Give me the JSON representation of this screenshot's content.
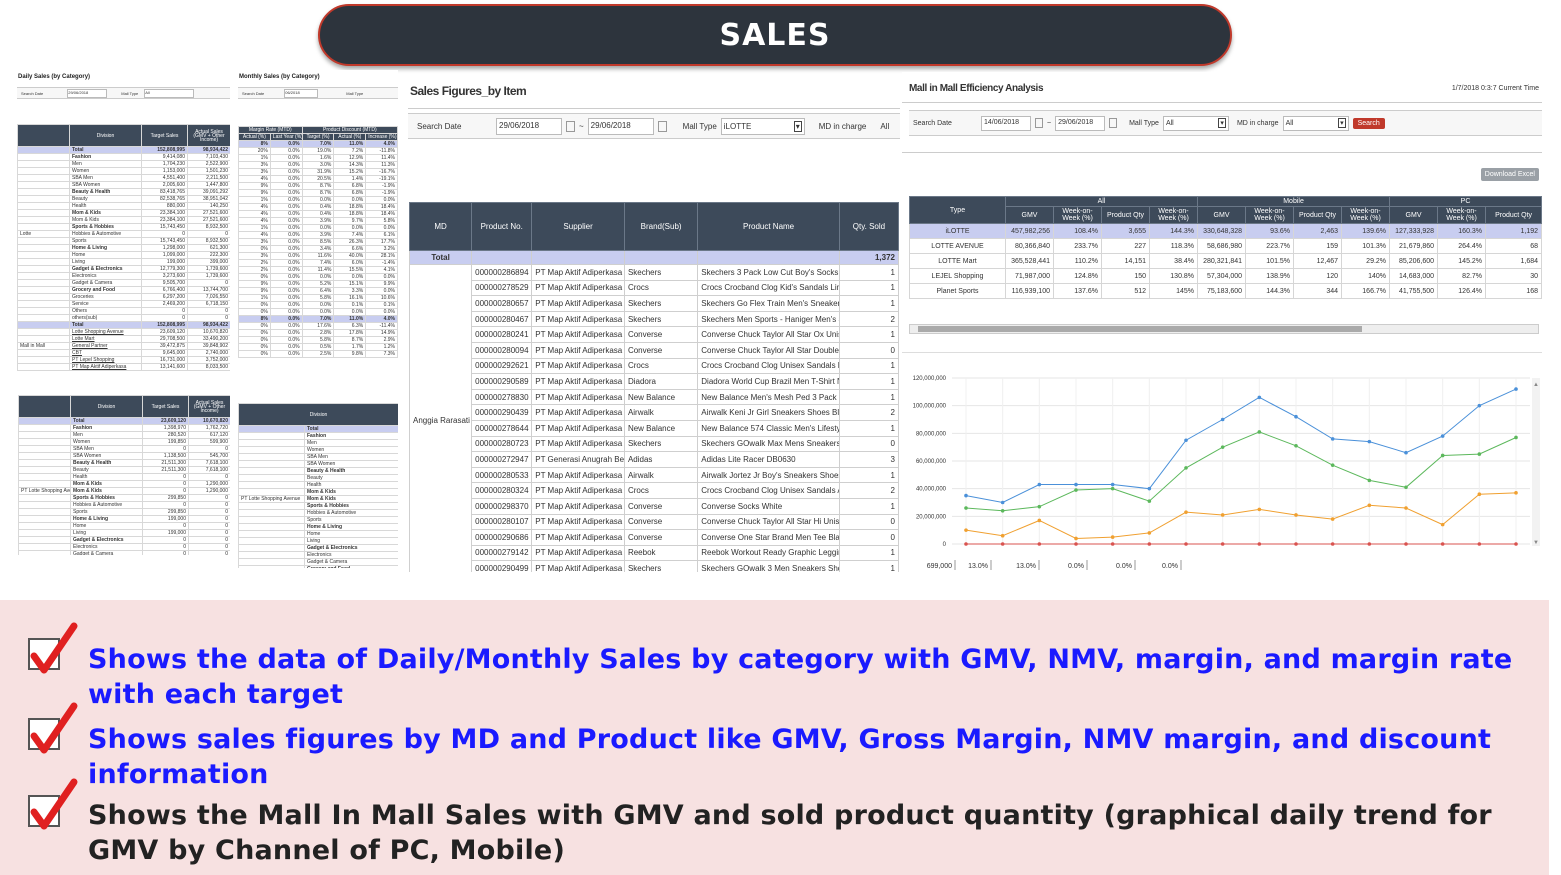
{
  "title": "SALES",
  "daily": {
    "title": "Daily Sales (by Category)",
    "search_label": "Search Date",
    "date": "29/06/2018",
    "mall_type_label": "Mall Type",
    "mall_type_value": "All",
    "headers": [
      "Division",
      "Target Sales",
      "Actual Sales (GMV + Other Income)"
    ],
    "group1": "Lotte",
    "group2": "Mall in Mall",
    "rows": [
      [
        "Total",
        "152,808,995",
        "98,934,422"
      ],
      [
        "Fashion",
        "9,414,080",
        "7,103,430"
      ],
      [
        "Men",
        "1,704,230",
        "2,522,900"
      ],
      [
        "Women",
        "1,153,000",
        "1,501,230"
      ],
      [
        "SBA Men",
        "4,551,400",
        "2,211,500"
      ],
      [
        "SBA Women",
        "2,005,600",
        "1,447,800"
      ],
      [
        "Beauty & Health",
        "83,418,765",
        "39,091,292"
      ],
      [
        "Beauty",
        "82,538,765",
        "38,951,042"
      ],
      [
        "Health",
        "880,000",
        "140,250"
      ],
      [
        "Mom & Kids",
        "23,384,100",
        "27,521,600"
      ],
      [
        "Mom & Kids",
        "23,384,100",
        "27,521,600"
      ],
      [
        "Sports & Hobbies",
        "15,743,450",
        "8,932,500"
      ],
      [
        "Hobbies & Automotive",
        "0",
        "0"
      ],
      [
        "Sports",
        "15,743,450",
        "8,932,500"
      ],
      [
        "Home & Living",
        "1,298,000",
        "621,300"
      ],
      [
        "Home",
        "1,099,000",
        "222,300"
      ],
      [
        "Living",
        "199,000",
        "399,000"
      ],
      [
        "Gadget & Electronics",
        "12,779,300",
        "1,739,600"
      ],
      [
        "Electronics",
        "3,273,600",
        "1,739,600"
      ],
      [
        "Gadget & Camera",
        "9,505,700",
        "0"
      ],
      [
        "Grocery and Food",
        "6,766,400",
        "13,744,700"
      ],
      [
        "Groceries",
        "6,297,200",
        "7,026,550"
      ],
      [
        "Service",
        "2,469,200",
        "6,718,150"
      ],
      [
        "Others",
        "0",
        "0"
      ],
      [
        "others(sub)",
        "0",
        "0"
      ],
      [
        "Total",
        "152,808,995",
        "98,934,422"
      ],
      [
        "Lotte Shopping Avenue",
        "23,609,120",
        "10,670,820"
      ],
      [
        "Lotte Mart",
        "29,708,500",
        "33,490,200"
      ],
      [
        "General Partner",
        "39,472,875",
        "39,848,902"
      ],
      [
        "CBT",
        "9,645,000",
        "2,740,000"
      ],
      [
        "PT Lepel Shopping",
        "16,731,000",
        "3,752,000"
      ],
      [
        "PT Map Aktif Adiperkasa",
        "13,141,600",
        "8,033,500"
      ]
    ]
  },
  "monthly": {
    "title": "Monthly Sales (by Category)",
    "search_label": "Search Date",
    "date": "06/2018",
    "mall_type_label": "Mall Type",
    "headers_group": [
      "Margin Rate (MTD)",
      "Product Discount (MTD)"
    ],
    "headers": [
      "Target (%)",
      "Actual (%)",
      "Last Year (%)",
      "Target (%)",
      "Actual (%)",
      "Increase (%)"
    ],
    "rows": [
      [
        "8%",
        "0.0%",
        "7.0%",
        "11.0%",
        "4.0%"
      ],
      [
        "20%",
        "0.0%",
        "19.0%",
        "7.2%",
        "-11.8%"
      ],
      [
        "1%",
        "0.0%",
        "1.6%",
        "12.9%",
        "11.4%"
      ],
      [
        "3%",
        "0.0%",
        "3.0%",
        "14.3%",
        "11.3%"
      ],
      [
        "3%",
        "0.0%",
        "31.9%",
        "15.2%",
        "-16.7%"
      ],
      [
        "4%",
        "0.0%",
        "20.5%",
        "1.4%",
        "-19.1%"
      ],
      [
        "9%",
        "0.0%",
        "8.7%",
        "6.8%",
        "-1.9%"
      ],
      [
        "9%",
        "0.0%",
        "8.7%",
        "6.8%",
        "-1.9%"
      ],
      [
        "1%",
        "0.0%",
        "0.0%",
        "0.0%",
        "0.0%"
      ],
      [
        "4%",
        "0.0%",
        "0.4%",
        "18.8%",
        "18.4%"
      ],
      [
        "4%",
        "0.0%",
        "0.4%",
        "18.8%",
        "18.4%"
      ],
      [
        "4%",
        "0.0%",
        "3.9%",
        "9.7%",
        "5.8%"
      ],
      [
        "1%",
        "0.0%",
        "0.0%",
        "0.0%",
        "0.0%"
      ],
      [
        "4%",
        "0.0%",
        "3.9%",
        "7.4%",
        "6.1%"
      ],
      [
        "3%",
        "0.0%",
        "8.5%",
        "26.3%",
        "17.7%"
      ],
      [
        "0%",
        "0.0%",
        "3.4%",
        "6.6%",
        "3.2%"
      ],
      [
        "3%",
        "0.0%",
        "11.6%",
        "40.0%",
        "28.1%"
      ],
      [
        "2%",
        "0.0%",
        "7.4%",
        "6.0%",
        "-1.4%"
      ],
      [
        "2%",
        "0.0%",
        "11.4%",
        "15.5%",
        "4.1%"
      ],
      [
        "0%",
        "0.0%",
        "0.0%",
        "0.0%",
        "0.0%"
      ],
      [
        "9%",
        "0.0%",
        "5.2%",
        "15.1%",
        "9.9%"
      ],
      [
        "9%",
        "0.0%",
        "6.4%",
        "3.3%",
        "0.0%"
      ],
      [
        "1%",
        "0.0%",
        "5.8%",
        "16.1%",
        "10.6%"
      ],
      [
        "0%",
        "0.0%",
        "0.0%",
        "0.1%",
        "0.1%"
      ],
      [
        "0%",
        "0.0%",
        "0.0%",
        "0.0%",
        "0.0%"
      ],
      [
        "8%",
        "0.0%",
        "7.0%",
        "11.0%",
        "4.0%"
      ],
      [
        "0%",
        "0.0%",
        "17.6%",
        "6.3%",
        "-11.4%"
      ],
      [
        "0%",
        "0.0%",
        "2.8%",
        "17.8%",
        "14.9%"
      ],
      [
        "0%",
        "0.0%",
        "5.8%",
        "8.7%",
        "2.9%"
      ],
      [
        "0%",
        "0.0%",
        "0.5%",
        "1.7%",
        "1.2%"
      ],
      [
        "0%",
        "0.0%",
        "2.5%",
        "9.8%",
        "7.3%"
      ]
    ]
  },
  "daily_mim": {
    "headers": [
      "Division",
      "Target Sales",
      "Actual Sales (GMV + Other Income)"
    ],
    "group": "PT Lotte Shopping Avenue",
    "rows": [
      [
        "Total",
        "23,609,120",
        "10,670,820"
      ],
      [
        "Fashion",
        "1,398,970",
        "1,762,720"
      ],
      [
        "Men",
        "280,520",
        "617,120"
      ],
      [
        "Women",
        "199,850",
        "599,900"
      ],
      [
        "SBA Men",
        "0",
        "0"
      ],
      [
        "SBA Women",
        "1,138,500",
        "545,700"
      ],
      [
        "Beauty & Health",
        "21,511,300",
        "7,618,100"
      ],
      [
        "Beauty",
        "21,511,300",
        "7,618,100"
      ],
      [
        "Health",
        "0",
        "0"
      ],
      [
        "Mom & Kids",
        "0",
        "1,290,000"
      ],
      [
        "Mom & Kids",
        "0",
        "1,290,000"
      ],
      [
        "Sports & Hobbies",
        "299,850",
        "0"
      ],
      [
        "Hobbies & Automotive",
        "0",
        "0"
      ],
      [
        "Sports",
        "299,850",
        "0"
      ],
      [
        "Home & Living",
        "199,000",
        "0"
      ],
      [
        "Home",
        "0",
        "0"
      ],
      [
        "Living",
        "199,000",
        "0"
      ],
      [
        "Gadget & Electronics",
        "0",
        "0"
      ],
      [
        "Electronics",
        "0",
        "0"
      ],
      [
        "Gadget & Camera",
        "0",
        "0"
      ],
      [
        "Grocery and Food",
        "0",
        "0"
      ]
    ]
  },
  "monthly_mim": {
    "header": "Division",
    "group": "PT Lotte Shopping Avenue",
    "rows": [
      "Total",
      "Fashion",
      "Men",
      "Women",
      "SBA Men",
      "SBA Women",
      "Beauty & Health",
      "Beauty",
      "Health",
      "Mom & Kids",
      "Mom & Kids",
      "Sports & Hobbies",
      "Hobbies & Automotive",
      "Sports",
      "Home & Living",
      "Home",
      "Living",
      "Gadget & Electronics",
      "Electronics",
      "Gadget & Camera",
      "Grocery and Food"
    ]
  },
  "items": {
    "title": "Sales Figures_by Item",
    "search_label": "Search Date",
    "date_from": "29/06/2018",
    "date_sep": "~",
    "date_to": "29/06/2018",
    "mall_type_label": "Mall Type",
    "mall_type_value": "iLOTTE",
    "md_label": "MD in charge",
    "md_value": "All",
    "headers": [
      "MD",
      "Product No.",
      "Supplier",
      "Brand(Sub)",
      "Product Name",
      "Qty. Sold"
    ],
    "total_label": "Total",
    "total_qty": "1,372",
    "md_name": "Anggia Rarasati",
    "rows": [
      [
        "000000286894",
        "PT Map Aktif Adiperkasa",
        "Skechers",
        "Skechers 3 Pack Low Cut Boy's Socks SKE",
        "1"
      ],
      [
        "000000278529",
        "PT Map Aktif Adiperkasa",
        "Crocs",
        "Crocs Crocband Clog Kid's Sandals Lime",
        "1"
      ],
      [
        "000000280657",
        "PT Map Aktif Adiperkasa",
        "Skechers",
        "Skechers Go Flex Train Men's Sneakers S",
        "1"
      ],
      [
        "000000280467",
        "PT Map Aktif Adiperkasa",
        "Skechers",
        "Skechers Men Sports - Haniger Men's Sn",
        "2"
      ],
      [
        "000000280241",
        "PT Map Aktif Adiperkasa",
        "Converse",
        "Converse Chuck Taylor All Star Ox Unisex",
        "1"
      ],
      [
        "000000280094",
        "PT Map Aktif Adiperkasa",
        "Converse",
        "Converse Chuck Taylor All Star Double Tc",
        "0"
      ],
      [
        "000000292621",
        "PT Map Aktif Adiperkasa",
        "Crocs",
        "Crocs Crocband Clog Unisex Sandals Lim",
        "1"
      ],
      [
        "000000290589",
        "PT Map Aktif Adiperkasa",
        "Diadora",
        "Diadora World Cup Brazil Men T-Shirt Na",
        "1"
      ],
      [
        "000000278830",
        "PT Map Aktif Adiperkasa",
        "New Balance",
        "New Balance Men's Mesh Ped 3 Pack Soc",
        "1"
      ],
      [
        "000000290439",
        "PT Map Aktif Adiperkasa",
        "Airwalk",
        "Airwalk Keni Jr Girl Sneakers Shoes Black",
        "2"
      ],
      [
        "000000278644",
        "PT Map Aktif Adiperkasa",
        "New Balance",
        "New Balance 574 Classic Men's Lifestyle S",
        "1"
      ],
      [
        "000000280723",
        "PT Map Aktif Adiperkasa",
        "Skechers",
        "Skechers GOwalk Max  Mens Sneakers Sl",
        "0"
      ],
      [
        "000000272947",
        "PT Generasi Anugrah Berk",
        "Adidas",
        "Adidas Lite Racer DB0630",
        "3"
      ],
      [
        "000000280533",
        "PT Map Aktif Adiperkasa",
        "Airwalk",
        "Airwalk Jortez Jr Boy's Sneakers Shoes Bl",
        "1"
      ],
      [
        "000000280324",
        "PT Map Aktif Adiperkasa",
        "Crocs",
        "Crocs Crocband Clog Unisex Sandals Aqu",
        "2"
      ],
      [
        "000000298370",
        "PT Map Aktif Adiperkasa",
        "Converse",
        "Converse Socks White",
        "1"
      ],
      [
        "000000280107",
        "PT Map Aktif Adiperkasa",
        "Converse",
        "Converse Chuck Taylor All Star Hi Unisex",
        "0"
      ],
      [
        "000000290686",
        "PT Map Aktif Adiperkasa",
        "Converse",
        "Converse One Star Brand Men Tee Black",
        "0"
      ],
      [
        "000000279142",
        "PT Map Aktif Adiperkasa",
        "Reebok",
        "Reebok Workout Ready Graphic Legging",
        "1"
      ],
      [
        "000000290499",
        "PT Map Aktif Adiperkasa",
        "Skechers",
        "Skechers GOwalk 3 Men Sneakers Shoes",
        "1"
      ]
    ]
  },
  "mall": {
    "title": "Mall in Mall Efficiency Analysis",
    "current_time": "1/7/2018 0:3:7 Current Time",
    "search_label": "Search Date",
    "date_from": "14/06/2018",
    "date_sep": "~",
    "date_to": "29/06/2018",
    "mall_type_label": "Mall Type",
    "mall_type_value": "All",
    "md_label": "MD in charge",
    "md_value": "All",
    "search_button": "Search",
    "download_button": "Download Excel",
    "type_header": "Type",
    "groups": [
      "All",
      "Mobile",
      "PC"
    ],
    "sub_headers": [
      "GMV",
      "Week-on-Week (%)",
      "Product Qty",
      "Week-on-Week (%)",
      "GMV",
      "Week-on-Week (%)",
      "Product Qty",
      "Week-on-Week (%)",
      "GMV",
      "Week-on-Week (%)",
      "Product Qty"
    ],
    "rows": [
      [
        "iLOTTE",
        "457,982,256",
        "108.4%",
        "3,655",
        "144.3%",
        "330,648,328",
        "93.6%",
        "2,463",
        "139.6%",
        "127,333,928",
        "160.3%",
        "1,192"
      ],
      [
        "LOTTE AVENUE",
        "80,366,840",
        "233.7%",
        "227",
        "118.3%",
        "58,686,980",
        "223.7%",
        "159",
        "101.3%",
        "21,679,860",
        "264.4%",
        "68"
      ],
      [
        "LOTTE Mart",
        "365,528,441",
        "110.2%",
        "14,151",
        "38.4%",
        "280,321,841",
        "101.5%",
        "12,467",
        "29.2%",
        "85,206,600",
        "145.2%",
        "1,684"
      ],
      [
        "LEJEL Shopping",
        "71,987,000",
        "124.8%",
        "150",
        "130.8%",
        "57,304,000",
        "138.9%",
        "120",
        "140%",
        "14,683,000",
        "82.7%",
        "30"
      ],
      [
        "Planet Sports",
        "116,939,100",
        "137.6%",
        "512",
        "145%",
        "75,183,600",
        "144.3%",
        "344",
        "166.7%",
        "41,755,500",
        "126.4%",
        "168"
      ]
    ],
    "footer": [
      "699,000",
      "13.0%",
      "13.0%",
      "0.0%",
      "0.0%",
      "0.0%"
    ]
  },
  "chart_data": {
    "type": "line",
    "y_ticks": [
      "120,000,000",
      "100,000,000",
      "80,000,000",
      "60,000,000",
      "40,000,000",
      "20,000,000",
      "0"
    ],
    "ylim": [
      0,
      120000000
    ],
    "n_points": 16,
    "series": [
      {
        "color": "#4a90d9",
        "values": [
          35000000,
          30000000,
          43000000,
          43000000,
          43000000,
          40000000,
          75000000,
          90000000,
          106000000,
          92000000,
          76000000,
          74000000,
          66000000,
          78000000,
          100000000,
          112000000
        ]
      },
      {
        "color": "#5cb85c",
        "values": [
          26000000,
          24000000,
          27000000,
          39000000,
          40000000,
          31000000,
          55000000,
          70000000,
          81000000,
          71000000,
          57000000,
          46000000,
          41000000,
          64000000,
          65000000,
          77000000
        ]
      },
      {
        "color": "#f0a030",
        "values": [
          10000000,
          6000000,
          17000000,
          4000000,
          5000000,
          8000000,
          23000000,
          21000000,
          25000000,
          21000000,
          18000000,
          28000000,
          26000000,
          14000000,
          36000000,
          37000000
        ]
      },
      {
        "color": "#d9534f",
        "values": [
          0,
          0,
          0,
          0,
          0,
          0,
          0,
          0,
          0,
          0,
          0,
          0,
          0,
          0,
          0,
          0
        ]
      }
    ],
    "grid": true
  },
  "notes": [
    "Shows the data of Daily/Monthly Sales by category with GMV, NMV, margin, and margin rate with each target",
    "Shows sales figures by MD and Product like GMV, Gross Margin, NMV margin, and discount information",
    "Shows the Mall In Mall Sales with GMV and sold product quantity (graphical daily trend for GMV by Channel of PC, Mobile)"
  ],
  "note_colors": [
    "#1a1aff",
    "#1a1aff",
    "#222222"
  ]
}
